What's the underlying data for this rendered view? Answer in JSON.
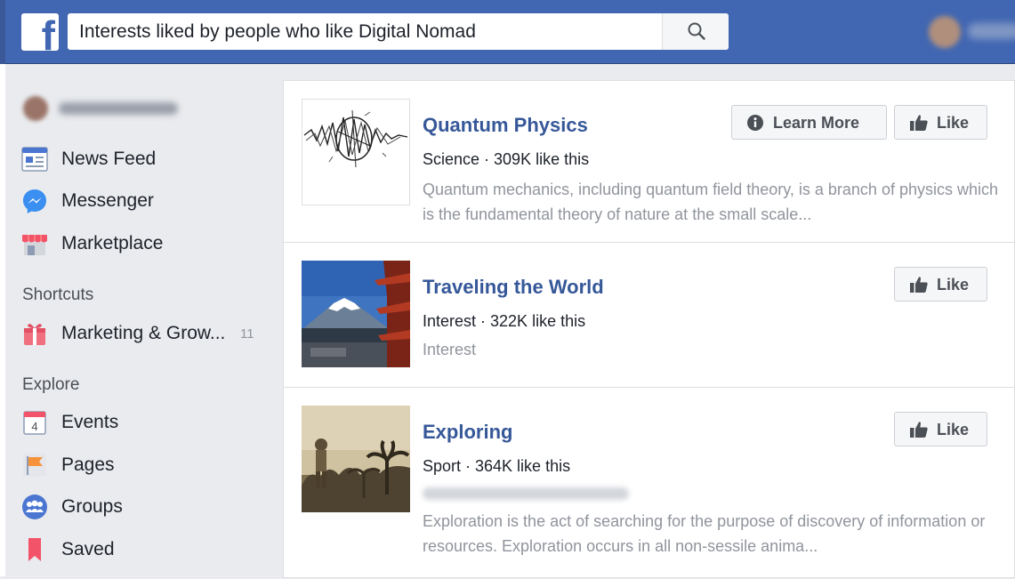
{
  "topbar": {
    "logo_letter": "f",
    "search_value": "Interests liked by people who like Digital Nomad",
    "search_icon": "search-icon",
    "brand_color": "#4267b2"
  },
  "sidebar": {
    "items": [
      {
        "label": "News Feed",
        "icon": "news-feed-icon"
      },
      {
        "label": "Messenger",
        "icon": "messenger-icon"
      },
      {
        "label": "Marketplace",
        "icon": "marketplace-icon"
      }
    ],
    "shortcuts_title": "Shortcuts",
    "shortcuts": [
      {
        "label": "Marketing & Grow...",
        "count": "11",
        "icon": "gift-icon"
      }
    ],
    "explore_title": "Explore",
    "explore": [
      {
        "label": "Events",
        "icon": "calendar-icon",
        "icon_text": "4"
      },
      {
        "label": "Pages",
        "icon": "flag-icon"
      },
      {
        "label": "Groups",
        "icon": "groups-icon"
      },
      {
        "label": "Saved",
        "icon": "bookmark-icon"
      }
    ]
  },
  "results": [
    {
      "title": "Quantum Physics",
      "meta": "Science · 309K like this",
      "description": "Quantum mechanics, including quantum field theory, is a branch of physics which is the fundamental theory of nature at the small scale...",
      "learn_more_label": "Learn More",
      "like_label": "Like"
    },
    {
      "title": "Traveling the World",
      "meta": "Interest · 322K like this",
      "description": "Interest",
      "like_label": "Like"
    },
    {
      "title": "Exploring",
      "meta": "Sport · 364K like this",
      "description": "Exploration is the act of searching for the purpose of discovery of information or resources. Exploration occurs in all non-sessile anima...",
      "like_label": "Like"
    }
  ],
  "colors": {
    "link_blue": "#365899",
    "page_bg": "#e9ebee",
    "muted_text": "#90949c"
  }
}
